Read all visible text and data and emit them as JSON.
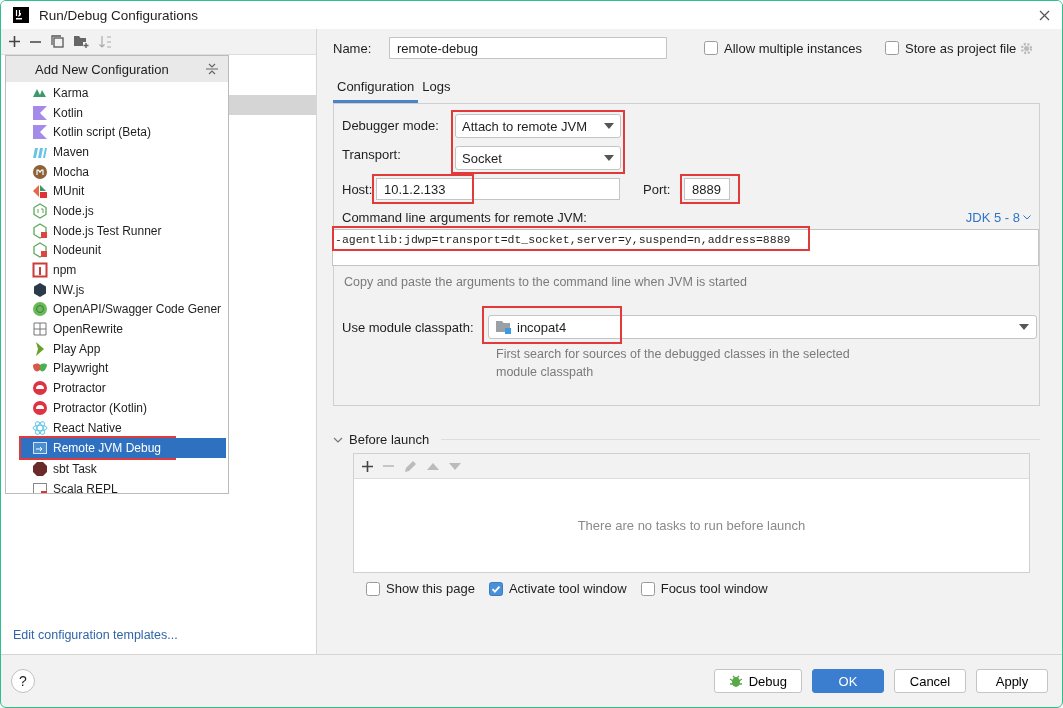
{
  "window": {
    "title": "Run/Debug Configurations"
  },
  "add_new_popup": {
    "title": "Add New Configuration",
    "items": [
      {
        "label": "Karma",
        "selected": false,
        "highlighted": false
      },
      {
        "label": "Kotlin",
        "selected": false,
        "highlighted": false
      },
      {
        "label": "Kotlin script (Beta)",
        "selected": false,
        "highlighted": false
      },
      {
        "label": "Maven",
        "selected": false,
        "highlighted": false
      },
      {
        "label": "Mocha",
        "selected": false,
        "highlighted": false
      },
      {
        "label": "MUnit",
        "selected": false,
        "highlighted": false
      },
      {
        "label": "Node.js",
        "selected": false,
        "highlighted": false
      },
      {
        "label": "Node.js Test Runner",
        "selected": false,
        "highlighted": false
      },
      {
        "label": "Nodeunit",
        "selected": false,
        "highlighted": false
      },
      {
        "label": "npm",
        "selected": false,
        "highlighted": false
      },
      {
        "label": "NW.js",
        "selected": false,
        "highlighted": false
      },
      {
        "label": "OpenAPI/Swagger Code Gener",
        "selected": false,
        "highlighted": false
      },
      {
        "label": "OpenRewrite",
        "selected": false,
        "highlighted": false
      },
      {
        "label": "Play App",
        "selected": false,
        "highlighted": false
      },
      {
        "label": "Playwright",
        "selected": false,
        "highlighted": false
      },
      {
        "label": "Protractor",
        "selected": false,
        "highlighted": false
      },
      {
        "label": "Protractor (Kotlin)",
        "selected": false,
        "highlighted": false
      },
      {
        "label": "React Native",
        "selected": false,
        "highlighted": false
      },
      {
        "label": "Remote JVM Debug",
        "selected": true,
        "highlighted": true
      },
      {
        "label": "sbt Task",
        "selected": false,
        "highlighted": false
      },
      {
        "label": "Scala REPL",
        "selected": false,
        "highlighted": false
      }
    ]
  },
  "edit_templates_link": "Edit configuration templates...",
  "name_field": {
    "label": "Name:",
    "value": "remote-debug"
  },
  "options": [
    {
      "label": "Allow multiple instances",
      "checked": false
    },
    {
      "label": "Store as project file",
      "checked": false
    }
  ],
  "tabs": [
    {
      "label": "Configuration",
      "selected": true
    },
    {
      "label": "Logs",
      "selected": false
    }
  ],
  "attach_settings": {
    "highlighted": true,
    "debugger_mode": {
      "label": "Debugger mode:",
      "value": "Attach to remote JVM"
    },
    "transport": {
      "label": "Transport:",
      "value": "Socket"
    }
  },
  "host": {
    "label": "Host:",
    "value": "10.1.2.133",
    "highlighted": true
  },
  "port": {
    "label": "Port:",
    "value": "8889",
    "highlighted": true
  },
  "command_line": {
    "label": "Command line arguments for remote JVM:",
    "jdk": "JDK 5 - 8",
    "value": "-agentlib:jdwp=transport=dt_socket,server=y,suspend=n,address=8889",
    "hint": "Copy and paste the arguments to the command line when JVM is started",
    "highlighted": true
  },
  "module_classpath": {
    "label": "Use module classpath:",
    "value": "incopat4",
    "hint": "First search for sources of the debugged classes in the selected module classpath",
    "highlighted": true
  },
  "before_launch": {
    "title": "Before launch",
    "expanded": true,
    "empty_text": "There are no tasks to run before launch",
    "options": [
      {
        "label": "Show this page",
        "checked": false
      },
      {
        "label": "Activate tool window",
        "checked": true
      },
      {
        "label": "Focus tool window",
        "checked": false
      }
    ]
  },
  "help_button": "?",
  "buttons": [
    {
      "label": "Debug",
      "kind": "run"
    },
    {
      "label": "OK",
      "kind": "primary"
    },
    {
      "label": "Cancel",
      "kind": "normal"
    },
    {
      "label": "Apply",
      "kind": "normal"
    }
  ]
}
